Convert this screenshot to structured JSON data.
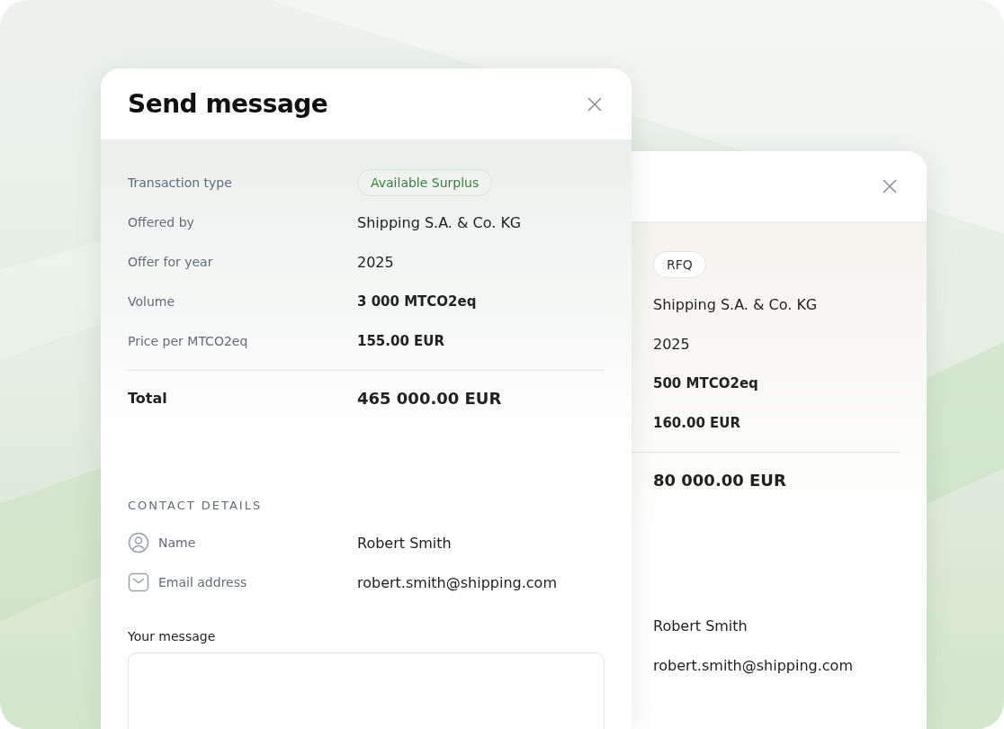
{
  "back_dialog": {
    "tag": {
      "label": "RFQ",
      "kind": "rfq"
    },
    "details": [
      {
        "value": "Shipping S.A. & Co. KG",
        "bold": false
      },
      {
        "value": "2025",
        "bold": false
      },
      {
        "value": "500 MTCO2eq",
        "bold": true
      },
      {
        "value": "160.00 EUR",
        "bold": true
      }
    ],
    "total": "80 000.00 EUR",
    "contact": [
      "Robert Smith",
      "robert.smith@shipping.com"
    ]
  },
  "dialog": {
    "title": "Send message",
    "transaction": {
      "label": "Transaction type",
      "tag": {
        "label": "Available Surplus",
        "kind": "surplus"
      }
    },
    "details": [
      {
        "label": "Offered by",
        "value": "Shipping S.A. & Co. KG",
        "bold": false
      },
      {
        "label": "Offer for year",
        "value": "2025",
        "bold": false
      },
      {
        "label": "Volume",
        "value": "3 000 MTCO2eq",
        "bold": true
      },
      {
        "label": "Price per MTCO2eq",
        "value": "155.00 EUR",
        "bold": true
      }
    ],
    "total": {
      "label": "Total",
      "value": "465 000.00 EUR"
    },
    "contact_heading": "CONTACT DETAILS",
    "contact": [
      {
        "kind": "person",
        "label": "Name",
        "value": "Robert Smith"
      },
      {
        "kind": "email",
        "label": "Email address",
        "value": "robert.smith@shipping.com"
      }
    ],
    "message": {
      "label": "Your message"
    }
  }
}
